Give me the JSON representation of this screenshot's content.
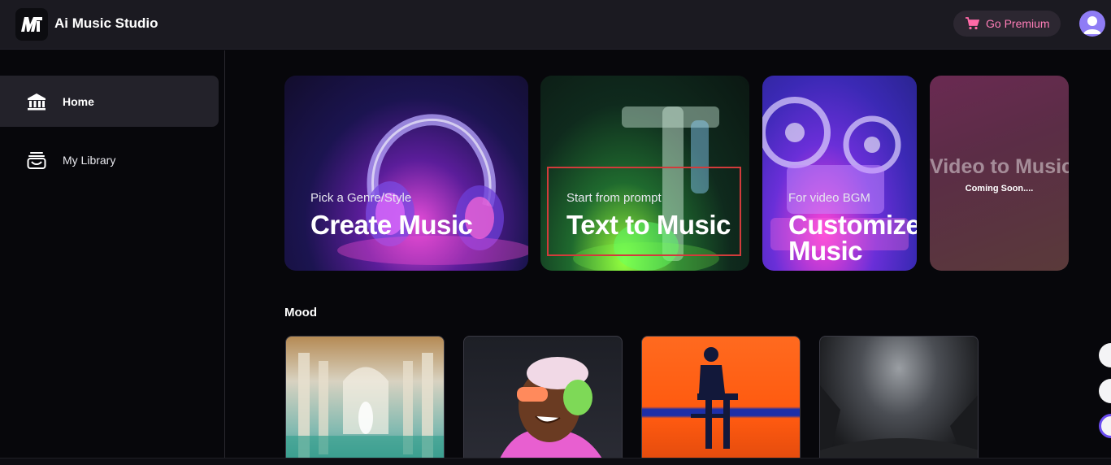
{
  "header": {
    "app_title": "Ai Music Studio",
    "premium_label": "Go Premium"
  },
  "sidebar": {
    "items": [
      {
        "label": "Home",
        "icon": "home-icon",
        "active": true
      },
      {
        "label": "My Library",
        "icon": "library-icon",
        "active": false
      }
    ]
  },
  "cards": [
    {
      "subtitle": "Pick a Genre/Style",
      "title": "Create Music"
    },
    {
      "subtitle": "Start from prompt",
      "title": "Text to Music"
    },
    {
      "subtitle": "For video BGM",
      "title_line1": "Customize",
      "title_line2": "Music"
    },
    {
      "title": "Video to Music",
      "subtitle": "Coming Soon...."
    }
  ],
  "mood": {
    "heading": "Mood"
  },
  "colors": {
    "accent_pink": "#ff7eb8",
    "highlight_red": "#d23b3b",
    "avatar": "#8f7cf5"
  }
}
